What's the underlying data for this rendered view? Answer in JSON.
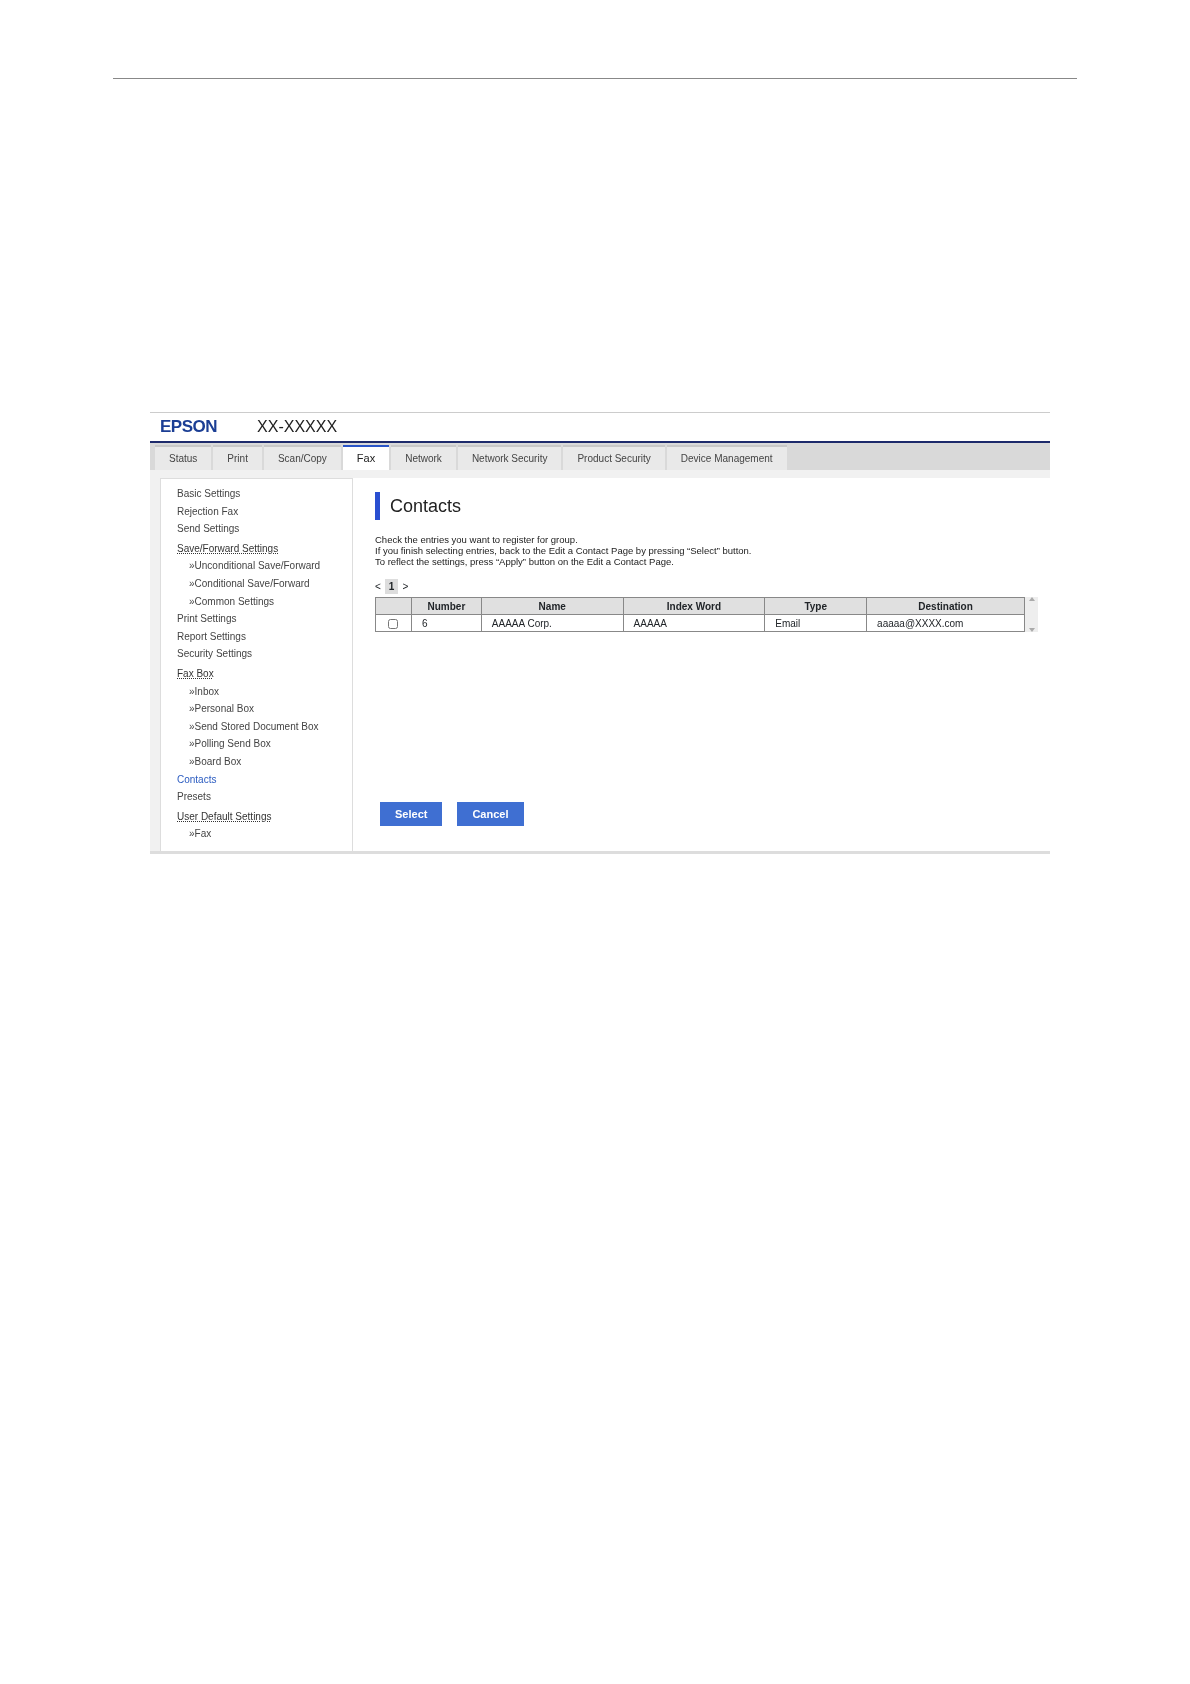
{
  "header": {
    "logo": "EPSON",
    "model": "XX-XXXXX"
  },
  "tabs": [
    {
      "label": "Status",
      "selected": false
    },
    {
      "label": "Print",
      "selected": false
    },
    {
      "label": "Scan/Copy",
      "selected": false
    },
    {
      "label": "Fax",
      "selected": true
    },
    {
      "label": "Network",
      "selected": false
    },
    {
      "label": "Network Security",
      "selected": false
    },
    {
      "label": "Product Security",
      "selected": false
    },
    {
      "label": "Device Management",
      "selected": false
    }
  ],
  "sidebar": {
    "items": [
      {
        "label": "Basic Settings",
        "kind": "link",
        "selected": false
      },
      {
        "label": "Rejection Fax",
        "kind": "link",
        "selected": false
      },
      {
        "label": "Send Settings",
        "kind": "link",
        "selected": false
      },
      {
        "label": "Save/Forward Settings",
        "kind": "group",
        "selected": false
      },
      {
        "label": "»Unconditional Save/Forward",
        "kind": "sub",
        "selected": false
      },
      {
        "label": "»Conditional Save/Forward",
        "kind": "sub",
        "selected": false
      },
      {
        "label": "»Common Settings",
        "kind": "sub",
        "selected": false
      },
      {
        "label": "Print Settings",
        "kind": "link",
        "selected": false
      },
      {
        "label": "Report Settings",
        "kind": "link",
        "selected": false
      },
      {
        "label": "Security Settings",
        "kind": "link",
        "selected": false
      },
      {
        "label": "Fax Box",
        "kind": "group",
        "selected": false
      },
      {
        "label": "»Inbox",
        "kind": "sub",
        "selected": false
      },
      {
        "label": "»Personal Box",
        "kind": "sub",
        "selected": false
      },
      {
        "label": "»Send Stored Document Box",
        "kind": "sub",
        "selected": false
      },
      {
        "label": "»Polling Send Box",
        "kind": "sub",
        "selected": false
      },
      {
        "label": "»Board Box",
        "kind": "sub",
        "selected": false
      },
      {
        "label": "Contacts",
        "kind": "link",
        "selected": true
      },
      {
        "label": "Presets",
        "kind": "link",
        "selected": false
      },
      {
        "label": "User Default Settings",
        "kind": "group",
        "selected": false
      },
      {
        "label": "»Fax",
        "kind": "sub",
        "selected": false
      }
    ]
  },
  "main": {
    "title": "Contacts",
    "instructions": [
      "Check the entries you want to register for group.",
      "If you finish selecting entries, back to the Edit a Contact Page by pressing “Select” button.",
      "To reflect the settings, press “Apply” button on the Edit a Contact Page."
    ],
    "pager": {
      "prev": "<",
      "page": "1",
      "next": ">"
    },
    "table": {
      "columns": [
        "",
        "Number",
        "Name",
        "Index Word",
        "Type",
        "Destination"
      ],
      "rows": [
        {
          "checked": false,
          "cells": [
            "",
            "6",
            "AAAAA Corp.",
            "AAAAA",
            "Email",
            "aaaaa@XXXX.com"
          ]
        }
      ]
    },
    "buttons": [
      "Select",
      "Cancel"
    ]
  }
}
